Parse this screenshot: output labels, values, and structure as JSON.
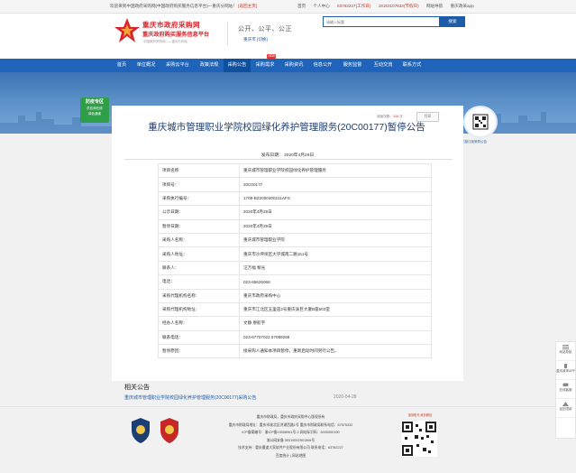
{
  "topbar": {
    "welcome": "欢迎来到中国政府采购网(中国政府购买服务信息平台)—重庆分网站！",
    "home_link": "[返回主页]",
    "links": [
      "首页",
      "个人中心"
    ],
    "phones": "63782227(工作日)",
    "phone2": "18183107833(节假日)",
    "app": "重庆政采app",
    "sitemap": "网站导航"
  },
  "header": {
    "site_title": "重庆市政府采购网",
    "site_sub": "重庆政府购买服务信息平台",
    "site_url": "中国政府采购网——重庆分网站",
    "slogan": "公开、公平、公正",
    "region": "重庆市 [切换]",
    "search_placeholder": "请输入标题",
    "search_button": "搜索"
  },
  "nav": {
    "items": [
      "首页",
      "单位概况",
      "采购云平台",
      "政策法规",
      "采购公告",
      "采购需求",
      "采购资讯",
      "信息公开",
      "服务监督",
      "互动交流",
      "联系方式"
    ],
    "badge": "NEW",
    "active": "采购公告"
  },
  "banner": {
    "promo_title": "防疫专区",
    "promo_line1": "供应商在线",
    "promo_line2": "绿色通道"
  },
  "side_qr_label": "扫描订阅采购公告",
  "article": {
    "views_label": "阅读次数：",
    "views": "348",
    "views_unit": "次",
    "print_button": "打印",
    "title": "重庆城市管理职业学院校园绿化养护管理服务(20C00177)暂停公告",
    "publish_date": "发布日期： 2020年4月29日",
    "rows": [
      {
        "k": "项目名称",
        "v": "重庆城市管理职业学院校园绿化养护管理服务"
      },
      {
        "k": "项目号：",
        "v": "20C00177"
      },
      {
        "k": "采购执行编号：",
        "v": "1708-BZ2000400211AFS"
      },
      {
        "k": "公示日期：",
        "v": "2020年4月28日"
      },
      {
        "k": "暂停日期：",
        "v": "2020年4月29日"
      },
      {
        "k": "采购人名称：",
        "v": "重庆城市管理职业学院"
      },
      {
        "k": "采购人地址：",
        "v": "重庆市沙坪坝区大学城南二路151号"
      },
      {
        "k": "联系人：",
        "v": "汪万福 黎光"
      },
      {
        "k": "电话：",
        "v": "023-65626068"
      },
      {
        "k": "采购代理机构名称：",
        "v": "重庆市政府采购中心"
      },
      {
        "k": "采购代理机构地址：",
        "v": "重庆市江北区五里店2号重庆渝巨大厦B座503室"
      },
      {
        "k": "经办人名称：",
        "v": "文静 廖航宇"
      },
      {
        "k": "联系电话：",
        "v": "023-67707022 67089268"
      },
      {
        "k": "暂停原因：",
        "v": "接采购人通知本项目暂停，重新启动时间另行公告。"
      }
    ]
  },
  "related": {
    "title": "相关公告",
    "link": "重庆城市管理职业学院校园绿化养护管理服务(20C00177)采购公告",
    "date": "2020-04-28"
  },
  "footer": {
    "lines": [
      "重庆市财政局，重庆市政府采购中心版权所有",
      "重庆市财政局地址：重庆市渝北区洪湖西路1号 重庆市财政局联系电话：67575332",
      "ICP备案编号：渝ICP备19008961号-2 网站标识码：5000000100",
      "渝公网安备 50019002501906号",
      "技术支持：重庆墨道大家软件产业股份有限公司 联系电话：63782227",
      "百度统计 | 网站地图"
    ],
    "qr_title": "渝采阳光 政务微信",
    "emblem_left": "police-emblem",
    "emblem_right": "party-emblem"
  },
  "sidebar": [
    "网站导航",
    "重庆政采APP",
    "在线客服",
    "返回顶部"
  ],
  "colors": {
    "brand_red": "#d8262c",
    "nav_blue": "#1f64b8",
    "title_blue": "#1d3e73"
  }
}
